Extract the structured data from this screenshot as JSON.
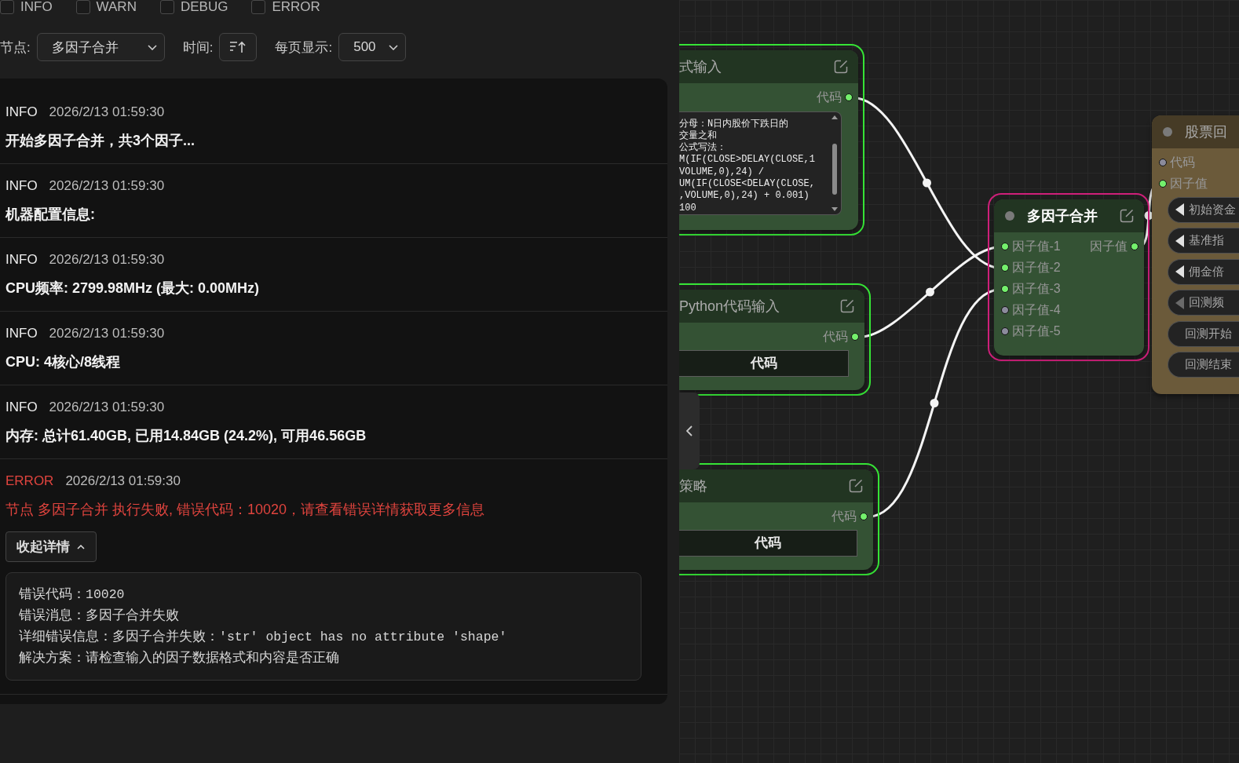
{
  "filters": [
    {
      "label": "INFO",
      "checked": false
    },
    {
      "label": "WARN",
      "checked": false
    },
    {
      "label": "DEBUG",
      "checked": false
    },
    {
      "label": "ERROR",
      "checked": false
    }
  ],
  "toolbar": {
    "node_label": "节点:",
    "node_value": "多因子合并",
    "time_label": "时间:",
    "page_size_label": "每页显示:",
    "page_size_value": "500"
  },
  "logs": [
    {
      "kind": "info",
      "tag": "INFO",
      "time": "2026/2/13 01:59:30",
      "message": "开始多因子合并，共3个因子..."
    },
    {
      "kind": "info",
      "tag": "INFO",
      "time": "2026/2/13 01:59:30",
      "message": "机器配置信息:"
    },
    {
      "kind": "info",
      "tag": "INFO",
      "time": "2026/2/13 01:59:30",
      "message": "CPU频率: 2799.98MHz (最大: 0.00MHz)"
    },
    {
      "kind": "info",
      "tag": "INFO",
      "time": "2026/2/13 01:59:30",
      "message": "CPU: 4核心/8线程"
    },
    {
      "kind": "info",
      "tag": "INFO",
      "time": "2026/2/13 01:59:30",
      "message": "内存: 总计61.40GB, 已用14.84GB (24.2%), 可用46.56GB"
    },
    {
      "kind": "error",
      "tag": "ERROR",
      "time": "2026/2/13 01:59:30",
      "message": "节点 多因子合并 执行失败, 错误代码：10020，请查看错误详情获取更多信息",
      "details_toggle": {
        "label": "收起详情",
        "expanded": true
      },
      "details": [
        "错误代码：10020",
        "错误消息：多因子合并失败",
        "详细错误信息：多因子合并失败：'str' object has no attribute 'shape'",
        "解决方案：请检查输入的因子数据格式和内容是否正确"
      ]
    }
  ],
  "canvas": {
    "nodes": [
      {
        "title": "式输入",
        "clipped_left": true,
        "clipped_right": false,
        "succeeded": true,
        "failed": false,
        "selected": false,
        "color": "#345234",
        "outputs": [
          {
            "label": "代码",
            "connected": true
          }
        ],
        "widgets": [
          {
            "kind": "textarea",
            "lines": [
              "分母：N日内股价下跌日的",
              "交量之和",
              "公式写法：",
              "M(IF(CLOSE>DELAY(CLOSE,1",
              "VOLUME,0),24) /",
              "UM(IF(CLOSE<DELAY(CLOSE,",
              ",VOLUME,0),24) + 0.001)",
              "100"
            ]
          }
        ]
      },
      {
        "title": "Python代码输入",
        "clipped_left": true,
        "clipped_right": false,
        "succeeded": true,
        "failed": false,
        "selected": false,
        "color": "#345234",
        "outputs": [
          {
            "label": "代码",
            "connected": true
          }
        ],
        "widgets": [
          {
            "kind": "button",
            "label": "代码"
          }
        ]
      },
      {
        "title": "策略",
        "clipped_left": true,
        "clipped_right": false,
        "succeeded": true,
        "failed": false,
        "selected": false,
        "color": "#345234",
        "outputs": [
          {
            "label": "代码",
            "connected": true
          }
        ],
        "widgets": [
          {
            "kind": "button",
            "label": "代码"
          }
        ]
      },
      {
        "title": "多因子合并",
        "clipped_left": false,
        "clipped_right": false,
        "succeeded": false,
        "failed": true,
        "selected": true,
        "color": "#345234",
        "inputs": [
          {
            "label": "因子值-1",
            "connected": true
          },
          {
            "label": "因子值-2",
            "connected": true
          },
          {
            "label": "因子值-3",
            "connected": true
          },
          {
            "label": "因子值-4",
            "connected": false
          },
          {
            "label": "因子值-5",
            "connected": false
          }
        ],
        "outputs": [
          {
            "label": "因子值",
            "connected": true
          }
        ]
      },
      {
        "title": "股票回",
        "clipped_left": false,
        "clipped_right": true,
        "succeeded": false,
        "failed": false,
        "selected": false,
        "color": "#6b5a3a",
        "inputs": [
          {
            "label": "代码",
            "connected": false
          },
          {
            "label": "因子值",
            "connected": true
          }
        ],
        "widgets": [
          {
            "kind": "stepper",
            "label": "初始资金",
            "arrow_disabled": false
          },
          {
            "kind": "stepper",
            "label": "基准指",
            "arrow_disabled": false
          },
          {
            "kind": "stepper",
            "label": "佣金倍",
            "arrow_disabled": false
          },
          {
            "kind": "stepper",
            "label": "回测频",
            "arrow_disabled": true
          },
          {
            "kind": "text",
            "label": "回测开始"
          },
          {
            "kind": "text",
            "label": "回测结束"
          }
        ]
      }
    ]
  }
}
